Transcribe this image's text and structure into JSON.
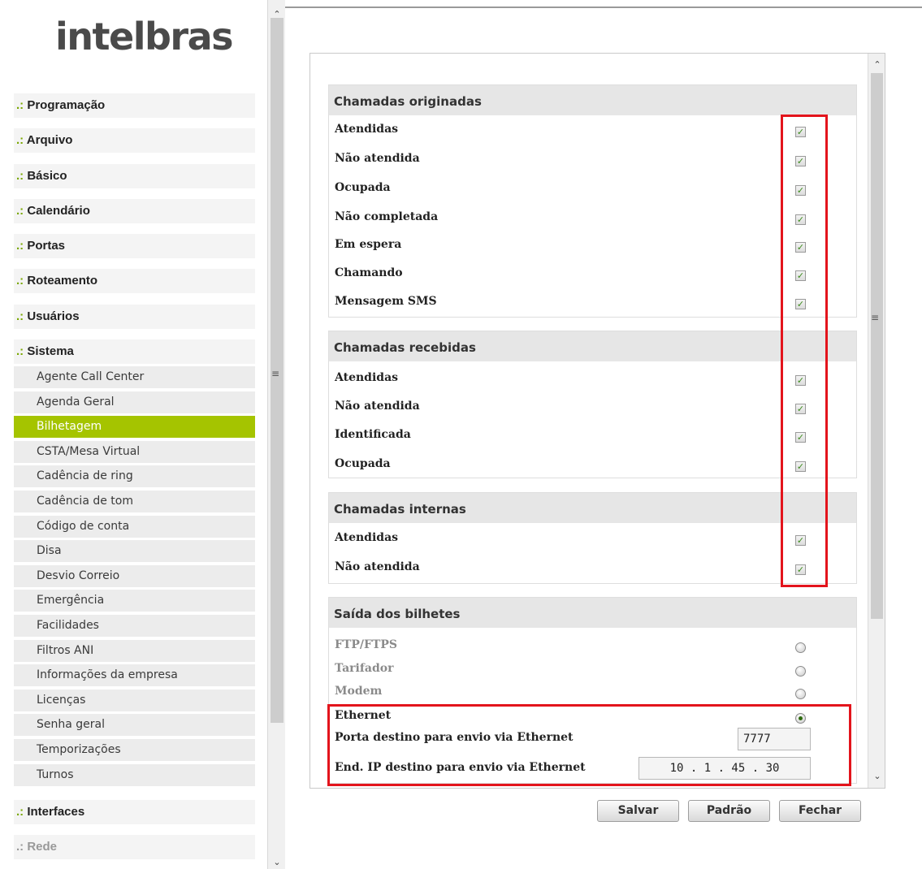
{
  "logo": {
    "text": "intelbras"
  },
  "menu": {
    "prefix": ".:",
    "top_items": [
      {
        "label": "Programação"
      },
      {
        "label": "Arquivo"
      },
      {
        "label": "Básico"
      },
      {
        "label": "Calendário"
      },
      {
        "label": "Portas"
      },
      {
        "label": "Roteamento"
      },
      {
        "label": "Usuários"
      },
      {
        "label": "Sistema"
      }
    ],
    "sub_items": [
      {
        "label": "Agente Call Center"
      },
      {
        "label": "Agenda Geral"
      },
      {
        "label": "Bilhetagem",
        "active": true
      },
      {
        "label": "CSTA/Mesa Virtual"
      },
      {
        "label": "Cadência de ring"
      },
      {
        "label": "Cadência de tom"
      },
      {
        "label": "Código de conta"
      },
      {
        "label": "Disa"
      },
      {
        "label": "Desvio Correio"
      },
      {
        "label": "Emergência"
      },
      {
        "label": "Facilidades"
      },
      {
        "label": "Filtros ANI"
      },
      {
        "label": "Informações da empresa"
      },
      {
        "label": "Licenças"
      },
      {
        "label": "Senha geral"
      },
      {
        "label": "Temporizações"
      },
      {
        "label": "Turnos"
      }
    ],
    "bottom_items": [
      {
        "label": "Interfaces"
      },
      {
        "label": "Rede",
        "disabled": true
      }
    ]
  },
  "sections": {
    "originadas": {
      "title": "Chamadas originadas",
      "rows": [
        {
          "label": "Atendidas",
          "checked": true
        },
        {
          "label": "Não atendida",
          "checked": true
        },
        {
          "label": "Ocupada",
          "checked": true
        },
        {
          "label": "Não completada",
          "checked": true
        },
        {
          "label": "Em espera",
          "checked": true
        },
        {
          "label": "Chamando",
          "checked": true
        },
        {
          "label": "Mensagem SMS",
          "checked": true
        }
      ]
    },
    "recebidas": {
      "title": "Chamadas recebidas",
      "rows": [
        {
          "label": "Atendidas",
          "checked": true
        },
        {
          "label": "Não atendida",
          "checked": true
        },
        {
          "label": "Identificada",
          "checked": true
        },
        {
          "label": "Ocupada",
          "checked": true
        }
      ]
    },
    "internas": {
      "title": "Chamadas internas",
      "rows": [
        {
          "label": "Atendidas",
          "checked": true
        },
        {
          "label": "Não atendida",
          "checked": true
        }
      ]
    },
    "saida": {
      "title": "Saída dos bilhetes",
      "options": [
        {
          "label": "FTP/FTPS",
          "selected": false
        },
        {
          "label": "Tarifador",
          "selected": false
        },
        {
          "label": "Modem",
          "selected": false
        },
        {
          "label": "Ethernet",
          "selected": true
        }
      ],
      "port_label": "Porta destino para envio via Ethernet",
      "port_value": "7777",
      "ip_label": "End. IP destino para envio via Ethernet",
      "ip_value": "10 . 1 . 45 . 30"
    }
  },
  "buttons": {
    "save": "Salvar",
    "default": "Padrão",
    "close": "Fechar"
  },
  "colors": {
    "accent": "#a5c400",
    "highlight": "#e3141c"
  },
  "icons": {
    "scroll_up": "chevron-up-icon",
    "scroll_down": "chevron-down-icon",
    "scroll_grip": "grip-icon"
  }
}
